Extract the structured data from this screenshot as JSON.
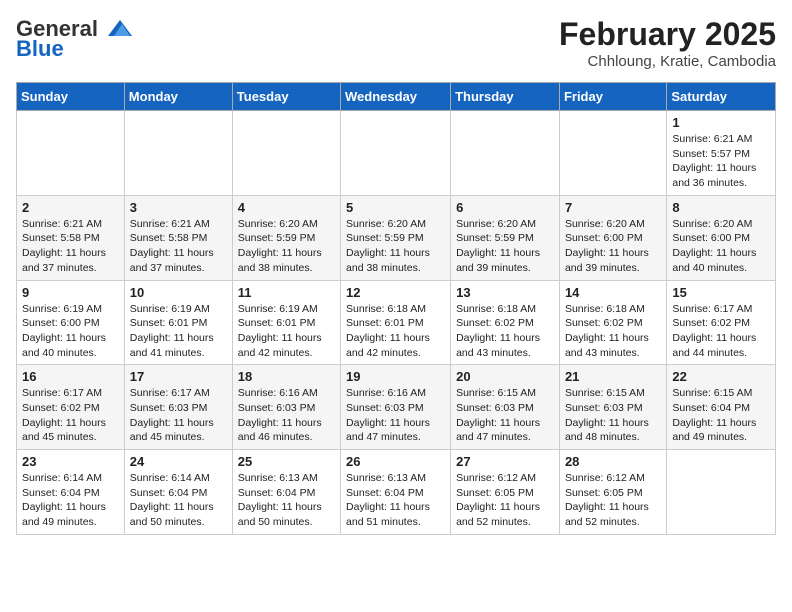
{
  "header": {
    "logo_general": "General",
    "logo_blue": "Blue",
    "month_title": "February 2025",
    "location": "Chhloung, Kratie, Cambodia"
  },
  "weekdays": [
    "Sunday",
    "Monday",
    "Tuesday",
    "Wednesday",
    "Thursday",
    "Friday",
    "Saturday"
  ],
  "weeks": [
    [
      {
        "day": "",
        "info": ""
      },
      {
        "day": "",
        "info": ""
      },
      {
        "day": "",
        "info": ""
      },
      {
        "day": "",
        "info": ""
      },
      {
        "day": "",
        "info": ""
      },
      {
        "day": "",
        "info": ""
      },
      {
        "day": "1",
        "info": "Sunrise: 6:21 AM\nSunset: 5:57 PM\nDaylight: 11 hours\nand 36 minutes."
      }
    ],
    [
      {
        "day": "2",
        "info": "Sunrise: 6:21 AM\nSunset: 5:58 PM\nDaylight: 11 hours\nand 37 minutes."
      },
      {
        "day": "3",
        "info": "Sunrise: 6:21 AM\nSunset: 5:58 PM\nDaylight: 11 hours\nand 37 minutes."
      },
      {
        "day": "4",
        "info": "Sunrise: 6:20 AM\nSunset: 5:59 PM\nDaylight: 11 hours\nand 38 minutes."
      },
      {
        "day": "5",
        "info": "Sunrise: 6:20 AM\nSunset: 5:59 PM\nDaylight: 11 hours\nand 38 minutes."
      },
      {
        "day": "6",
        "info": "Sunrise: 6:20 AM\nSunset: 5:59 PM\nDaylight: 11 hours\nand 39 minutes."
      },
      {
        "day": "7",
        "info": "Sunrise: 6:20 AM\nSunset: 6:00 PM\nDaylight: 11 hours\nand 39 minutes."
      },
      {
        "day": "8",
        "info": "Sunrise: 6:20 AM\nSunset: 6:00 PM\nDaylight: 11 hours\nand 40 minutes."
      }
    ],
    [
      {
        "day": "9",
        "info": "Sunrise: 6:19 AM\nSunset: 6:00 PM\nDaylight: 11 hours\nand 40 minutes."
      },
      {
        "day": "10",
        "info": "Sunrise: 6:19 AM\nSunset: 6:01 PM\nDaylight: 11 hours\nand 41 minutes."
      },
      {
        "day": "11",
        "info": "Sunrise: 6:19 AM\nSunset: 6:01 PM\nDaylight: 11 hours\nand 42 minutes."
      },
      {
        "day": "12",
        "info": "Sunrise: 6:18 AM\nSunset: 6:01 PM\nDaylight: 11 hours\nand 42 minutes."
      },
      {
        "day": "13",
        "info": "Sunrise: 6:18 AM\nSunset: 6:02 PM\nDaylight: 11 hours\nand 43 minutes."
      },
      {
        "day": "14",
        "info": "Sunrise: 6:18 AM\nSunset: 6:02 PM\nDaylight: 11 hours\nand 43 minutes."
      },
      {
        "day": "15",
        "info": "Sunrise: 6:17 AM\nSunset: 6:02 PM\nDaylight: 11 hours\nand 44 minutes."
      }
    ],
    [
      {
        "day": "16",
        "info": "Sunrise: 6:17 AM\nSunset: 6:02 PM\nDaylight: 11 hours\nand 45 minutes."
      },
      {
        "day": "17",
        "info": "Sunrise: 6:17 AM\nSunset: 6:03 PM\nDaylight: 11 hours\nand 45 minutes."
      },
      {
        "day": "18",
        "info": "Sunrise: 6:16 AM\nSunset: 6:03 PM\nDaylight: 11 hours\nand 46 minutes."
      },
      {
        "day": "19",
        "info": "Sunrise: 6:16 AM\nSunset: 6:03 PM\nDaylight: 11 hours\nand 47 minutes."
      },
      {
        "day": "20",
        "info": "Sunrise: 6:15 AM\nSunset: 6:03 PM\nDaylight: 11 hours\nand 47 minutes."
      },
      {
        "day": "21",
        "info": "Sunrise: 6:15 AM\nSunset: 6:03 PM\nDaylight: 11 hours\nand 48 minutes."
      },
      {
        "day": "22",
        "info": "Sunrise: 6:15 AM\nSunset: 6:04 PM\nDaylight: 11 hours\nand 49 minutes."
      }
    ],
    [
      {
        "day": "23",
        "info": "Sunrise: 6:14 AM\nSunset: 6:04 PM\nDaylight: 11 hours\nand 49 minutes."
      },
      {
        "day": "24",
        "info": "Sunrise: 6:14 AM\nSunset: 6:04 PM\nDaylight: 11 hours\nand 50 minutes."
      },
      {
        "day": "25",
        "info": "Sunrise: 6:13 AM\nSunset: 6:04 PM\nDaylight: 11 hours\nand 50 minutes."
      },
      {
        "day": "26",
        "info": "Sunrise: 6:13 AM\nSunset: 6:04 PM\nDaylight: 11 hours\nand 51 minutes."
      },
      {
        "day": "27",
        "info": "Sunrise: 6:12 AM\nSunset: 6:05 PM\nDaylight: 11 hours\nand 52 minutes."
      },
      {
        "day": "28",
        "info": "Sunrise: 6:12 AM\nSunset: 6:05 PM\nDaylight: 11 hours\nand 52 minutes."
      },
      {
        "day": "",
        "info": ""
      }
    ]
  ]
}
